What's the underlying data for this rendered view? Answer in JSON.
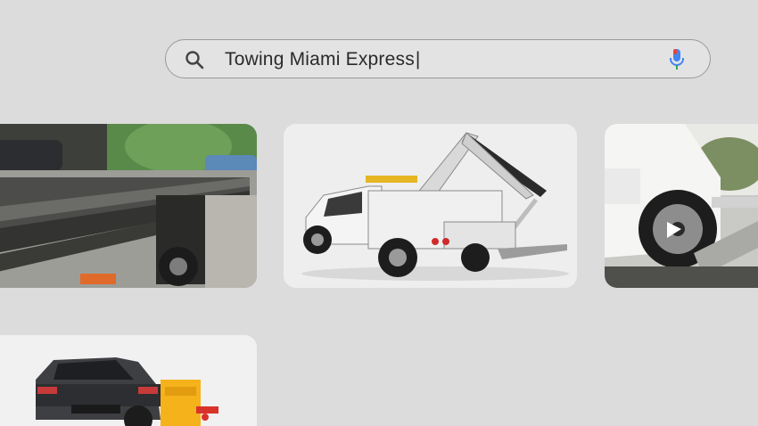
{
  "search": {
    "query": "Towing Miami Express",
    "search_icon": "search-icon",
    "mic_icon": "microphone-icon"
  },
  "results": [
    {
      "image": "flatbed-tow-truck-photo"
    },
    {
      "image": "white-wrecker-tow-truck-photo"
    },
    {
      "image": "white-car-on-ramp-photo"
    },
    {
      "image": "dark-suv-tow-truck-photo"
    }
  ],
  "colors": {
    "background": "#dcdcdc",
    "mic_blue": "#4285f4",
    "mic_red": "#ea4335",
    "tow_yellow": "#f5b21b"
  }
}
